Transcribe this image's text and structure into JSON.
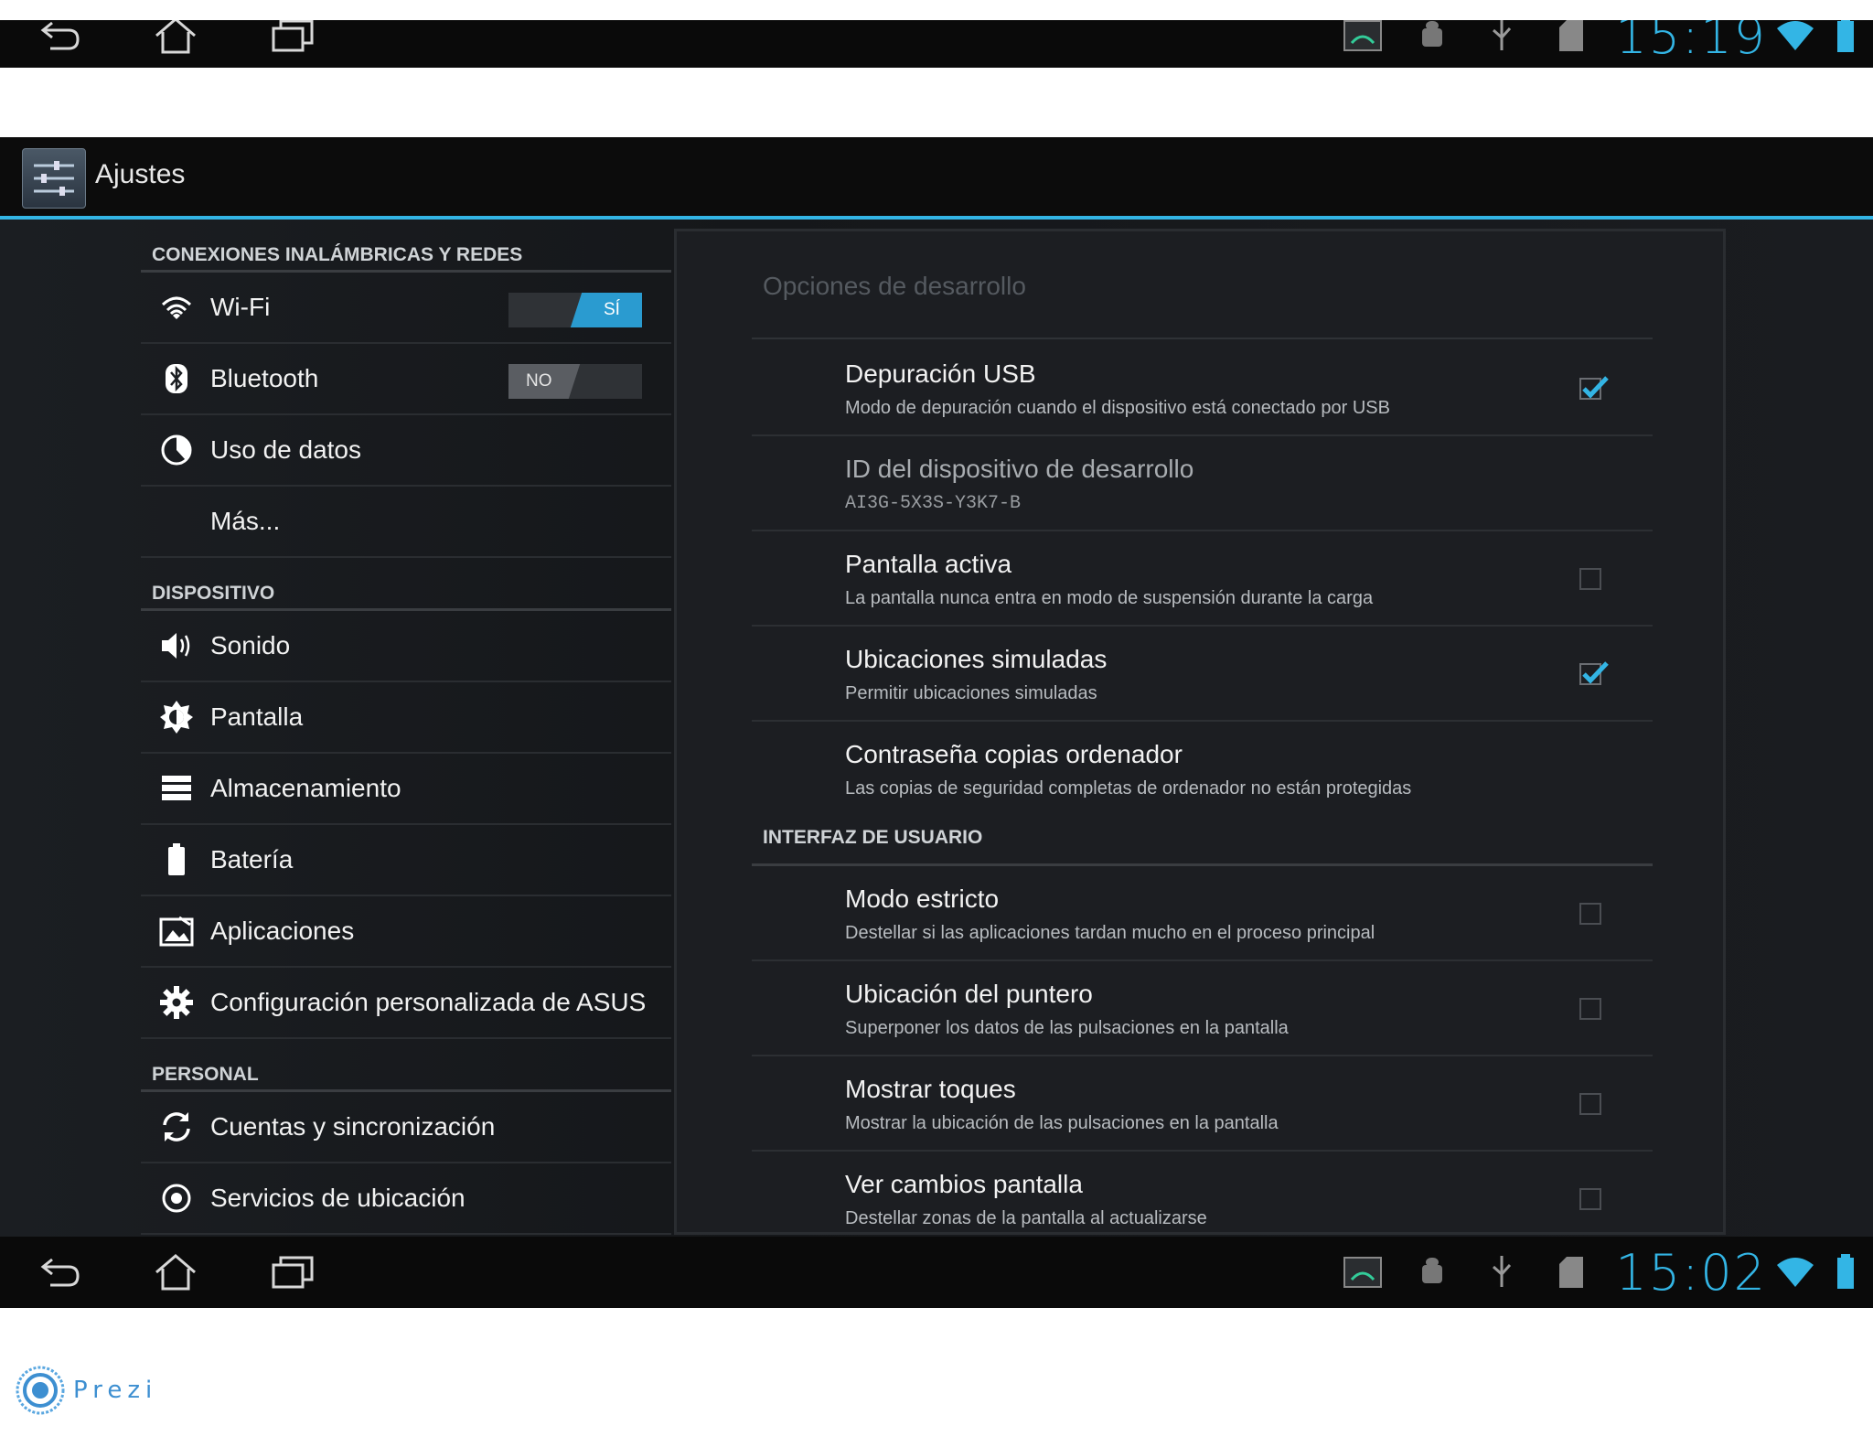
{
  "status_bar_top": {
    "time": "15:19"
  },
  "status_bar_bottom": {
    "time": "15:02"
  },
  "action_bar": {
    "title": "Ajustes"
  },
  "sidebar": {
    "sections": [
      {
        "header": "CONEXIONES INALÁMBRICAS Y REDES",
        "items": [
          {
            "label": "Wi-Fi",
            "icon": "wifi-icon",
            "toggle": "SÍ"
          },
          {
            "label": "Bluetooth",
            "icon": "bluetooth-icon",
            "toggle": "NO"
          },
          {
            "label": "Uso de datos",
            "icon": "data-usage-icon"
          },
          {
            "label": "Más..."
          }
        ]
      },
      {
        "header": "DISPOSITIVO",
        "items": [
          {
            "label": "Sonido",
            "icon": "speaker-icon"
          },
          {
            "label": "Pantalla",
            "icon": "brightness-icon"
          },
          {
            "label": "Almacenamiento",
            "icon": "storage-icon"
          },
          {
            "label": "Batería",
            "icon": "battery-icon"
          },
          {
            "label": "Aplicaciones",
            "icon": "apps-icon"
          },
          {
            "label": "Configuración personalizada de ASUS",
            "icon": "gear-icon"
          }
        ]
      },
      {
        "header": "PERSONAL",
        "items": [
          {
            "label": "Cuentas y sincronización",
            "icon": "sync-icon"
          },
          {
            "label": "Servicios de ubicación",
            "icon": "location-icon"
          }
        ]
      }
    ]
  },
  "developer": {
    "title": "Opciones de desarrollo",
    "options": [
      {
        "title": "Depuración USB",
        "summary": "Modo de depuración cuando el dispositivo está conectado por USB",
        "checked": true
      },
      {
        "title": "ID del dispositivo de desarrollo",
        "summary": "AI3G-5X3S-Y3K7-B"
      },
      {
        "title": "Pantalla activa",
        "summary": "La pantalla nunca entra en modo de suspensión durante la carga",
        "checked": false
      },
      {
        "title": "Ubicaciones simuladas",
        "summary": "Permitir ubicaciones simuladas",
        "checked": true
      },
      {
        "title": "Contraseña copias ordenador",
        "summary": "Las copias de seguridad completas de ordenador no están protegidas"
      }
    ],
    "ui_section": "INTERFAZ DE USUARIO",
    "ui_options": [
      {
        "title": "Modo estricto",
        "summary": "Destellar si las aplicaciones tardan mucho en el proceso principal",
        "checked": false
      },
      {
        "title": "Ubicación del puntero",
        "summary": "Superponer los datos de las pulsaciones en la pantalla",
        "checked": false
      },
      {
        "title": "Mostrar toques",
        "summary": "Mostrar la ubicación de las pulsaciones en la pantalla",
        "checked": false
      },
      {
        "title": "Ver cambios pantalla",
        "summary": "Destellar zonas de la pantalla al actualizarse",
        "checked": false
      }
    ]
  },
  "watermark": {
    "text": "Prezi"
  },
  "colors": {
    "accent": "#33b5e5",
    "background": "#1b1e22"
  }
}
